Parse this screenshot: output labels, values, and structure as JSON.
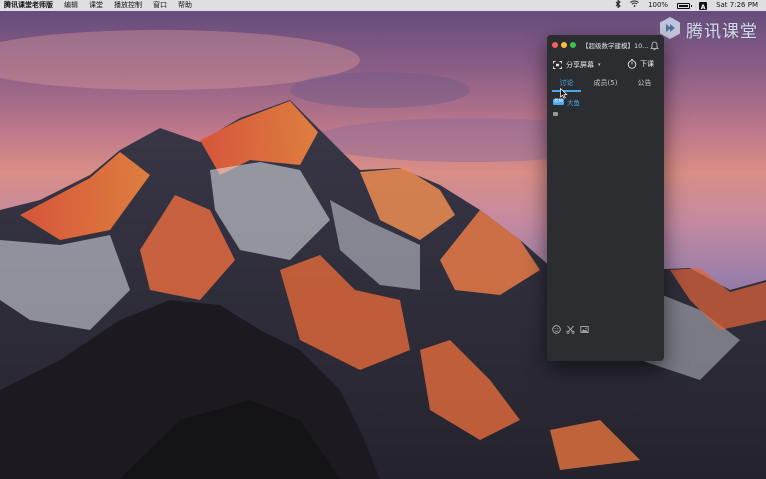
{
  "menubar": {
    "app_name": "腾讯课堂老师版",
    "items": [
      "编辑",
      "课堂",
      "播放控制",
      "窗口",
      "帮助"
    ],
    "battery_text": "100%",
    "battery_level": 1.0,
    "input_source": "A",
    "clock": "Sat 7:26 PM"
  },
  "watermark": {
    "text": "腾讯课堂",
    "color": "#e9f2fb"
  },
  "window": {
    "title": "【超级数学建模】10...",
    "toolbar": {
      "share_label": "分享屏幕",
      "share_caret": "▾",
      "end_class_label": "下课"
    },
    "tabs": [
      {
        "label": "讨论",
        "active": true
      },
      {
        "label": "成员(5)",
        "active": false
      },
      {
        "label": "公告",
        "active": false
      }
    ],
    "chat": {
      "messages": [
        {
          "badge": "老师",
          "sender": "大鱼"
        }
      ]
    },
    "input_tools": [
      "emoji-icon",
      "scissors-icon",
      "image-icon"
    ],
    "accent_color": "#4aa8f3",
    "background_color": "#2c2d31"
  }
}
